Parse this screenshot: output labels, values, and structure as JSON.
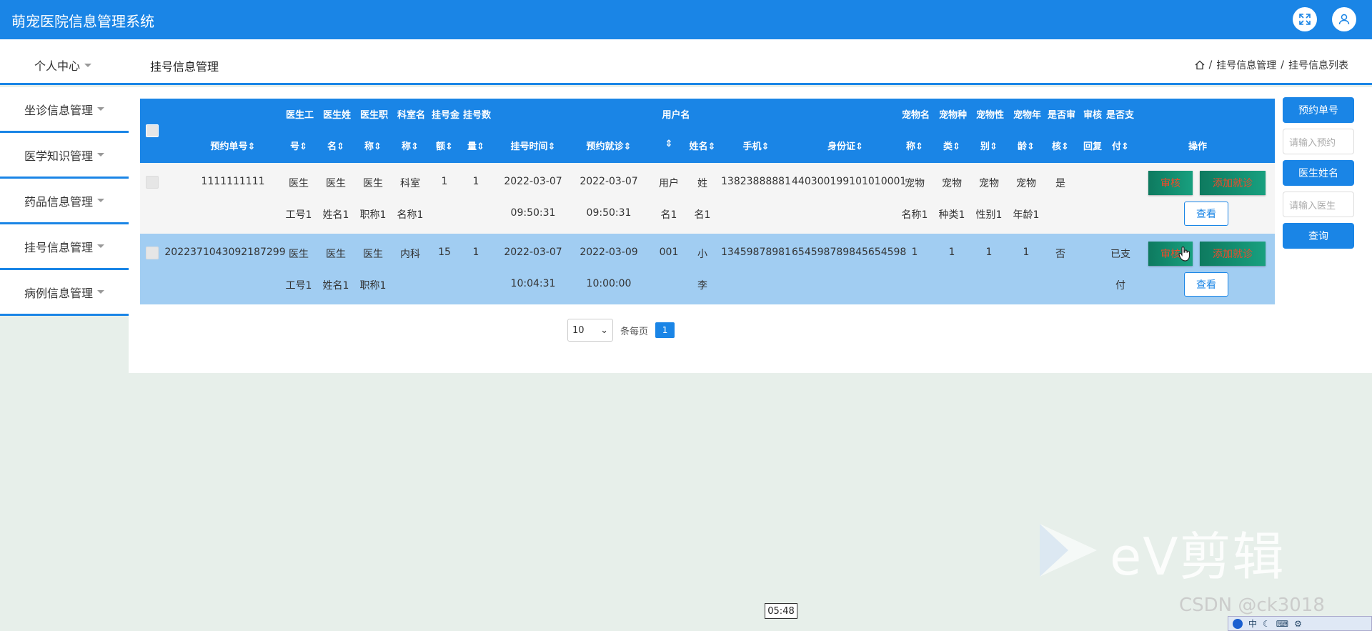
{
  "app": {
    "title": "萌宠医院信息管理系统"
  },
  "header": {
    "page_title": "挂号信息管理",
    "personal_center": "个人中心",
    "breadcrumb": [
      "挂号信息管理",
      "挂号信息列表"
    ],
    "breadcrumb_sep": "/"
  },
  "sidebar": {
    "items": [
      {
        "label": "坐诊信息管理"
      },
      {
        "label": "医学知识管理"
      },
      {
        "label": "药品信息管理"
      },
      {
        "label": "挂号信息管理"
      },
      {
        "label": "病例信息管理"
      }
    ]
  },
  "table": {
    "headers_top": {
      "doc_no": "医生工",
      "doc_name": "医生姓",
      "doc_title": "医生职",
      "dept": "科室名",
      "fee": "挂号金",
      "count": "挂号数",
      "username": "用户名",
      "pet_name": "宠物名",
      "pet_type": "宠物种",
      "pet_sex": "宠物性",
      "pet_age": "宠物年",
      "audit": "是否审",
      "audit_reply": "审核",
      "paid": "是否支"
    },
    "headers_bottom": {
      "order_no": "预约单号",
      "doc_no": "号",
      "doc_name": "名",
      "doc_title": "称",
      "dept": "称",
      "fee": "额",
      "count": "量",
      "reg_time": "挂号时间",
      "visit_time": "预约就诊",
      "username": "",
      "name": "姓名",
      "phone": "手机",
      "idcard": "身份证",
      "pet_name": "称",
      "pet_type": "类",
      "pet_sex": "别",
      "pet_age": "龄",
      "audit": "核",
      "audit_reply": "回复",
      "paid": "付",
      "ops": "操作"
    },
    "rows": [
      {
        "order_no": "1111111111",
        "doc_no": [
          "医生",
          "工号1"
        ],
        "doc_name": [
          "医生",
          "姓名1"
        ],
        "doc_title": [
          "医生",
          "职称1"
        ],
        "dept": [
          "科室",
          "名称1"
        ],
        "fee": "1",
        "count": "1",
        "reg_time": [
          "2022-03-07",
          "09:50:31"
        ],
        "visit_time": [
          "2022-03-07",
          "09:50:31"
        ],
        "username": [
          "用户",
          "名1"
        ],
        "name": [
          "姓",
          "名1"
        ],
        "phone": "13823888881",
        "idcard": "440300199101010001",
        "pet_name": [
          "宠物",
          "名称1"
        ],
        "pet_type": [
          "宠物",
          "种类1"
        ],
        "pet_sex": [
          "宠物",
          "性别1"
        ],
        "pet_age": [
          "宠物",
          "年龄1"
        ],
        "audit": "是",
        "audit_reply": "",
        "paid": [
          "",
          ""
        ],
        "btn_audit": "审核",
        "btn_add_visit": "添加就诊",
        "btn_view": "查看"
      },
      {
        "order_no": "2022371043092187299",
        "doc_no": [
          "医生",
          "工号1"
        ],
        "doc_name": [
          "医生",
          "姓名1"
        ],
        "doc_title": [
          "医生",
          "职称1"
        ],
        "dept": [
          "内科",
          ""
        ],
        "fee": "15",
        "count": "1",
        "reg_time": [
          "2022-03-07",
          "10:04:31"
        ],
        "visit_time": [
          "2022-03-09",
          "10:00:00"
        ],
        "username": [
          "001",
          ""
        ],
        "name": [
          "小",
          "李"
        ],
        "phone": "13459878981",
        "idcard": "654598789845654598",
        "pet_name": [
          "1",
          ""
        ],
        "pet_type": [
          "1",
          ""
        ],
        "pet_sex": [
          "1",
          ""
        ],
        "pet_age": [
          "1",
          ""
        ],
        "audit": "否",
        "audit_reply": "",
        "paid": [
          "已支",
          "付"
        ],
        "btn_audit": "审核",
        "btn_add_visit": "添加就诊",
        "btn_view": "查看"
      }
    ]
  },
  "pagination": {
    "page_size": "10",
    "per_page_label": "条每页",
    "current_page": "1"
  },
  "search": {
    "order_no_button": "预约单号",
    "order_no_placeholder": "请输入预约",
    "doctor_name_button": "医生姓名",
    "doctor_name_placeholder": "请输入医生",
    "query_button": "查询"
  },
  "overlay": {
    "ev_watermark": "eV剪辑",
    "csdn_watermark": "CSDN @ck3018",
    "timer": "05:48",
    "ime": "中"
  },
  "colors": {
    "primary": "#1a85e6",
    "green_button": "#0e7a5f",
    "row_selected": "#a1cdf2"
  }
}
